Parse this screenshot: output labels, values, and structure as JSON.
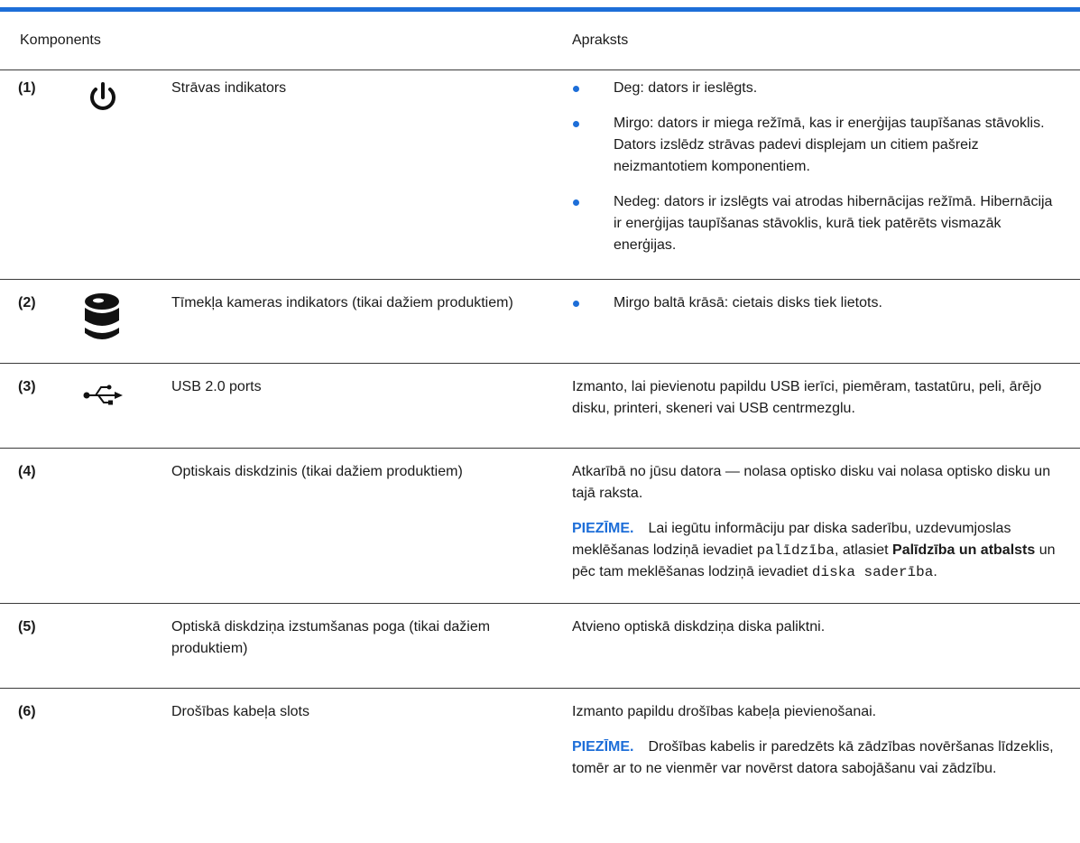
{
  "header": {
    "col_left": "Komponents",
    "col_right": "Apraksts"
  },
  "rows": [
    {
      "num": "(1)",
      "icon": "power-icon",
      "name": "Strāvas indikators",
      "bullets": [
        "Deg: dators ir ieslēgts.",
        "Mirgo: dators ir miega režīmā, kas ir enerģijas taupīšanas stāvoklis. Dators izslēdz strāvas padevi displejam un citiem pašreiz neizmantotiem komponentiem.",
        "Nedeg: dators ir izslēgts vai atrodas hibernācijas režīmā. Hibernācija ir enerģijas taupīšanas stāvoklis, kurā tiek patērēts vismazāk enerģijas."
      ]
    },
    {
      "num": "(2)",
      "icon": "hard-drive-icon",
      "name": "Tīmekļa kameras indikators (tikai dažiem produktiem)",
      "bullets": [
        "Mirgo baltā krāsā: cietais disks tiek lietots."
      ]
    },
    {
      "num": "(3)",
      "icon": "usb-icon",
      "name": "USB 2.0 ports",
      "desc": "Izmanto, lai pievienotu papildu USB ierīci, piemēram, tastatūru, peli, ārējo disku, printeri, skeneri vai USB centrmezglu."
    },
    {
      "num": "(4)",
      "name": "Optiskais diskdzinis (tikai dažiem produktiem)",
      "desc": "Atkarībā no jūsu datora — nolasa optisko disku vai nolasa optisko disku un tajā raksta.",
      "note": {
        "label": "PIEZĪME.",
        "t1": "Lai iegūtu informāciju par diska saderību, uzdevumjoslas meklēšanas lodziņā ievadiet ",
        "code1": "palīdzība",
        "t2": ", atlasiet ",
        "bold": "Palīdzība un atbalsts",
        "t3": " un pēc tam meklēšanas lodziņā ievadiet ",
        "code2": "diska saderība",
        "t4": "."
      }
    },
    {
      "num": "(5)",
      "name": "Optiskā diskdziņa izstumšanas poga (tikai dažiem produktiem)",
      "desc": "Atvieno optiskā diskdziņa diska paliktni."
    },
    {
      "num": "(6)",
      "name": "Drošības kabeļa slots",
      "desc": "Izmanto papildu drošības kabeļa pievienošanai.",
      "note": {
        "label": "PIEZĪME.",
        "text": "Drošības kabelis ir paredzēts kā zādzības novēršanas līdzeklis, tomēr ar to ne vienmēr var novērst datora sabojāšanu vai zādzību."
      }
    }
  ],
  "colors": {
    "accent": "#1d6ed8",
    "rule": "#3a3a3a"
  }
}
